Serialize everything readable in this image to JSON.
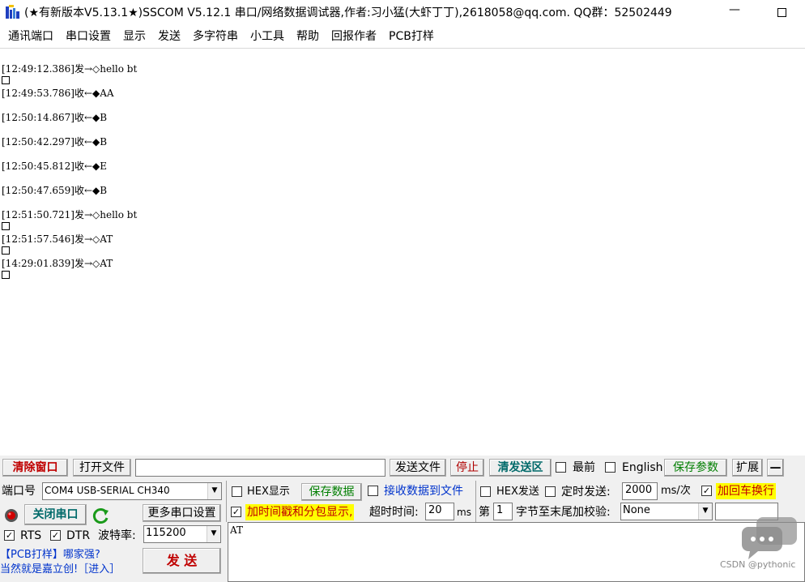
{
  "window": {
    "title": "(★有新版本V5.13.1★)SSCOM V5.12.1 串口/网络数据调试器,作者:习小猛(大虾丁丁),2618058@qq.com. QQ群：52502449",
    "minimize": "—"
  },
  "menu": [
    "通讯端口",
    "串口设置",
    "显示",
    "发送",
    "多字符串",
    "小工具",
    "帮助",
    "回报作者",
    "PCB打样"
  ],
  "log": [
    "[12:49:12.386]发→◇hello bt",
    "[12:49:53.786]收←◆AA",
    "[12:50:14.867]收←◆B",
    "[12:50:42.297]收←◆B",
    "[12:50:45.812]收←◆E",
    "[12:50:47.659]收←◆B",
    "[12:51:50.721]发→◇hello bt",
    "[12:51:57.546]发→◇AT",
    "[14:29:01.839]发→◇AT"
  ],
  "toolbar": {
    "clear": "清除窗口",
    "open_file": "打开文件",
    "file_path": "",
    "send_file": "发送文件",
    "stop": "停止",
    "clear_send": "清发送区",
    "topmost": "最前",
    "english": "English",
    "save_params": "保存参数",
    "expand": "扩展",
    "collapse": "—"
  },
  "port": {
    "label": "端口号",
    "value": "COM4 USB-SERIAL CH340",
    "close_btn": "关闭串口",
    "more_settings": "更多串口设置",
    "rts": "RTS",
    "dtr": "DTR",
    "baud_label": "波特率:",
    "baud": "115200"
  },
  "options": {
    "hex_display": "HEX显示",
    "save_data": "保存数据",
    "recv_to_file": "接收数据到文件",
    "timestamp": "加时间戳和分包显示,",
    "timeout_label": "超时时间:",
    "timeout": "20",
    "timeout_unit": "ms",
    "hex_send": "HEX发送",
    "timed_send": "定时发送:",
    "interval": "2000",
    "interval_unit": "ms/次",
    "crlf": "加回车换行",
    "byte_prefix": "第",
    "byte_index": "1",
    "byte_suffix": "字节至末尾加校验:",
    "checksum": "None",
    "checksum_extra": ""
  },
  "send": {
    "text": "AT",
    "send_btn": "发  送"
  },
  "promo": {
    "line1": "【PCB打样】哪家强?",
    "line2": "当然就是嘉立创!［进入］"
  },
  "watermark": "CSDN @pythonic"
}
